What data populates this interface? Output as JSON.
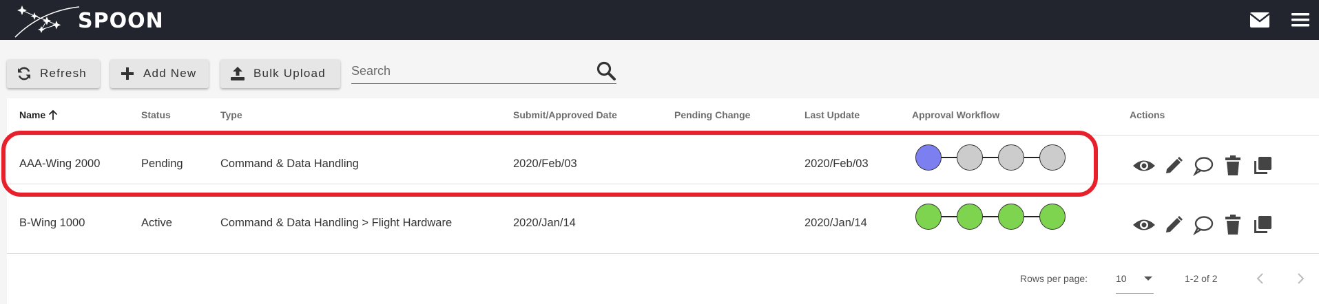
{
  "app": {
    "logo_text": "SPOON"
  },
  "toolbar": {
    "refresh_label": "Refresh",
    "add_label": "Add New",
    "bulk_label": "Bulk Upload",
    "search_placeholder": "Search"
  },
  "table": {
    "columns": [
      "Name",
      "Status",
      "Type",
      "Submit/Approved Date",
      "Pending Change",
      "Last Update",
      "Approval Workflow",
      "Actions"
    ],
    "sort_column": "Name",
    "sort_direction": "ascending",
    "rows": [
      {
        "name": "AAA-Wing 2000",
        "status": "Pending",
        "type": "Command & Data Handling",
        "submit_date": "2020/Feb/03",
        "pending_change": "",
        "last_update": "2020/Feb/03",
        "workflow": [
          "#7b7ff0",
          "#cccccc",
          "#cccccc",
          "#cccccc"
        ],
        "highlighted": true
      },
      {
        "name": "B-Wing 1000",
        "status": "Active",
        "type": "Command & Data Handling > Flight Hardware",
        "submit_date": "2020/Jan/14",
        "pending_change": "",
        "last_update": "2020/Jan/14",
        "workflow": [
          "#7ed34f",
          "#7ed34f",
          "#7ed34f",
          "#7ed34f"
        ],
        "highlighted": false
      }
    ],
    "actions": [
      "view-icon",
      "edit-icon",
      "comment-icon",
      "delete-icon",
      "copy-icon"
    ]
  },
  "footer": {
    "rows_per_page_label": "Rows per page:",
    "rows_per_page_value": "10",
    "range_text": "1-2 of 2"
  },
  "colors": {
    "topbar": "#22252e",
    "highlight": "#e8202b",
    "workflow_current": "#7b7ff0",
    "workflow_done": "#7ed34f",
    "workflow_pending": "#cccccc"
  }
}
